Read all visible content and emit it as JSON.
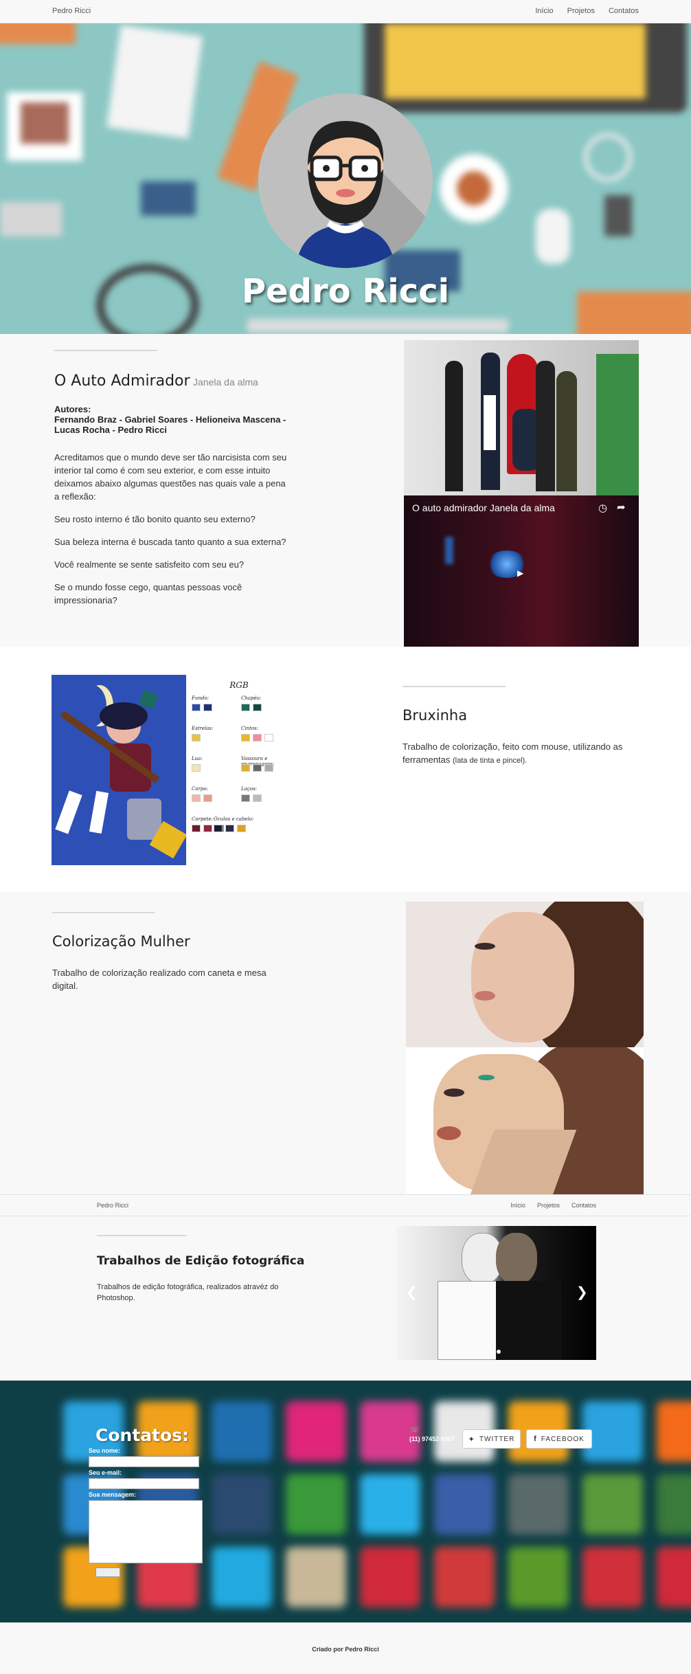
{
  "nav": {
    "brand": "Pedro Ricci",
    "links": [
      "Início",
      "Projetos",
      "Contatos"
    ]
  },
  "hero": {
    "name": "Pedro Ricci"
  },
  "project1": {
    "title": "O Auto Admirador",
    "subtitle": "Janela da alma",
    "authors_label": "Autores:",
    "authors": "Fernando Braz - Gabriel Soares - Helioneiva Mascena - Lucas Rocha - Pedro Ricci",
    "paragraphs": [
      "Acreditamos que o mundo deve ser tão narcisista com seu interior tal como é com seu exterior, e com esse intuito deixamos abaixo algumas questões nas quais vale a pena a reflexão:",
      "Seu rosto interno é tão bonito quanto seu externo?",
      "Sua beleza interna é buscada tanto quanto a sua externa?",
      "Você realmente se sente satisfeito com seu eu?",
      "Se o mundo fosse cego, quantas pessoas você impressionaria?"
    ],
    "video_title": "O auto admirador Janela da alma"
  },
  "project2": {
    "title": "Bruxinha",
    "desc": "Trabalho de colorização, feito com mouse, utilizando as ferramentas",
    "desc_small": "(lata de tinta e pincel).",
    "palette_title": "RGB",
    "palette_labels": [
      "Fundo:",
      "Chapéu:",
      "Estrelas:",
      "Cintos:",
      "Lua:",
      "Vassoura e engrenagens:",
      "Corpo:",
      "Laços:",
      "Corpete:",
      "Óculos e cabelo:"
    ]
  },
  "project3": {
    "title": "Colorização Mulher",
    "desc": "Trabalho de colorização realizado com caneta e mesa digital."
  },
  "nav2": {
    "brand": "Pedro Ricci",
    "links": [
      "Início",
      "Projetos",
      "Contatos"
    ]
  },
  "project4": {
    "title": "Trabalhos de Edição fotográfica",
    "desc": "Trabalhos de edição fotográfica, realizados atravéz do Photoshop."
  },
  "contact": {
    "title": "Contatos:",
    "name_label": "Seu nome:",
    "email_label": "Seu e-mail:",
    "message_label": "Sua mensagem:",
    "phone": "(11) 97452-9307",
    "twitter": "TWITTER",
    "facebook": "FACEBOOK"
  },
  "footer": {
    "credit": "Criado por Pedro Ricci"
  },
  "colors": {
    "contact_bg": "#0f3f46",
    "hero_bg": "#8cc7c4"
  }
}
